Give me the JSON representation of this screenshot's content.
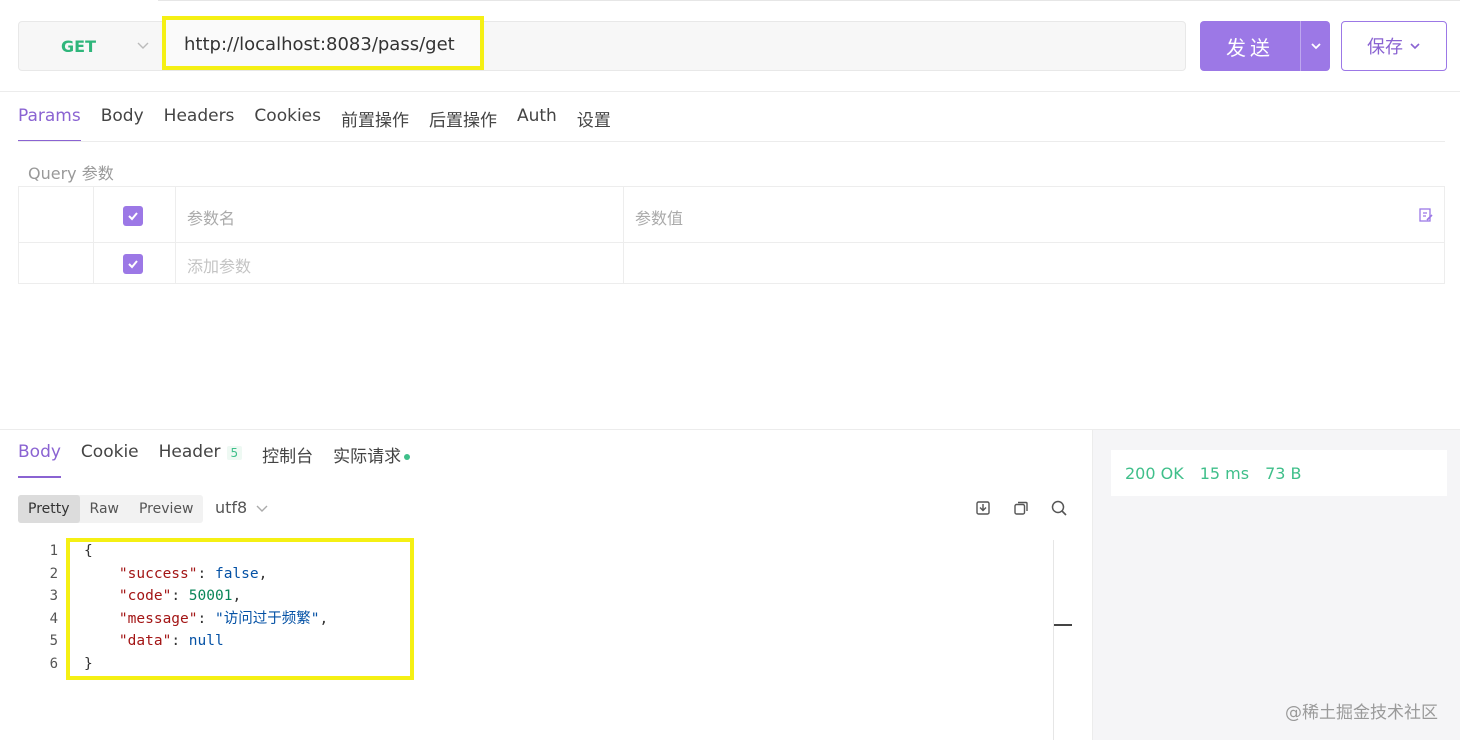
{
  "request": {
    "method": "GET",
    "url": "http://localhost:8083/pass/get",
    "send_label": "发送",
    "save_label": "保存"
  },
  "request_tabs": [
    {
      "label": "Params",
      "active": true
    },
    {
      "label": "Body"
    },
    {
      "label": "Headers"
    },
    {
      "label": "Cookies"
    },
    {
      "label": "前置操作"
    },
    {
      "label": "后置操作"
    },
    {
      "label": "Auth"
    },
    {
      "label": "设置"
    }
  ],
  "params": {
    "section_label": "Query 参数",
    "name_header": "参数名",
    "value_header": "参数值",
    "add_placeholder": "添加参数"
  },
  "response_tabs": {
    "body": "Body",
    "cookie": "Cookie",
    "header": "Header",
    "header_count": "5",
    "console": "控制台",
    "actual_request": "实际请求"
  },
  "view_modes": {
    "pretty": "Pretty",
    "raw": "Raw",
    "preview": "Preview"
  },
  "encoding": "utf8",
  "status": {
    "code": "200 OK",
    "time": "15 ms",
    "size": "73 B"
  },
  "code": {
    "line_numbers": [
      "1",
      "2",
      "3",
      "4",
      "5",
      "6"
    ],
    "open_brace": "{",
    "close_brace": "}",
    "success_key": "\"success\"",
    "success_val": "false",
    "code_key": "\"code\"",
    "code_val": "50001",
    "message_key": "\"message\"",
    "message_val": "\"访问过于频繁\"",
    "data_key": "\"data\"",
    "data_val": "null"
  },
  "watermark": "@稀土掘金技术社区",
  "colors": {
    "accent": "#9c78e6",
    "method_get": "#2fb67b",
    "status_ok": "#3fbf8a",
    "highlight": "#f5f014"
  }
}
